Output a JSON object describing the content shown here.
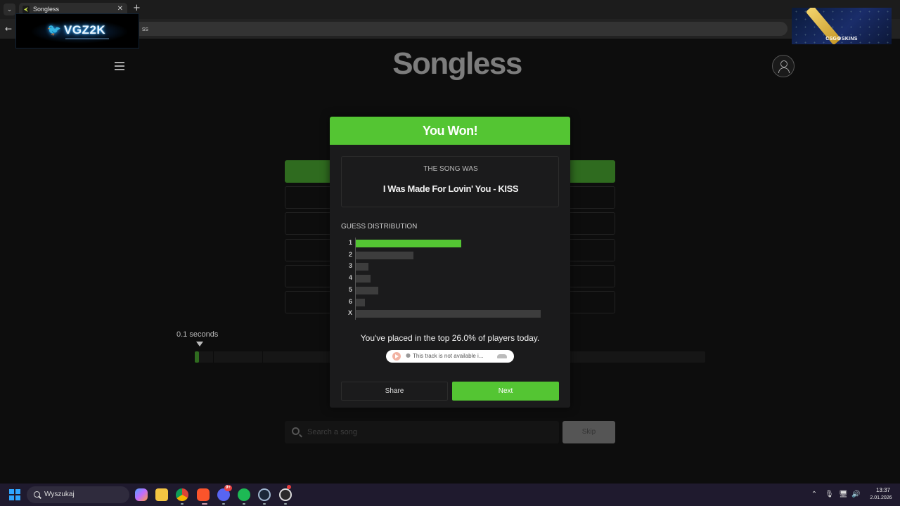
{
  "browser": {
    "tab_title": "Songless",
    "tab_close": "✕",
    "new_tab": "+",
    "address_fragment": "ss"
  },
  "overlays": {
    "streamer_badge": "VGZ2K",
    "sponsor_badge": "CSG⚙SKINS"
  },
  "app": {
    "logo": "Songless",
    "duration_label": "0.1 seconds",
    "progress_fraction": 0.008,
    "search_placeholder": "Search a song",
    "skip_label": "Skip"
  },
  "modal": {
    "title": "You Won!",
    "song_label": "THE SONG WAS",
    "song_title": "I Was Made For Lovin' You - KISS",
    "distribution_title": "GUESS DISTRIBUTION",
    "distribution": [
      {
        "label": "1",
        "value": 0.57,
        "highlight": true
      },
      {
        "label": "2",
        "value": 0.31,
        "highlight": false
      },
      {
        "label": "3",
        "value": 0.07,
        "highlight": false
      },
      {
        "label": "4",
        "value": 0.08,
        "highlight": false
      },
      {
        "label": "5",
        "value": 0.12,
        "highlight": false
      },
      {
        "label": "6",
        "value": 0.05,
        "highlight": false
      },
      {
        "label": "X",
        "value": 1.0,
        "highlight": false
      }
    ],
    "placement_text": "You've placed in the top 26.0% of players today.",
    "soundcloud_text": "This track is not available i...",
    "share_label": "Share",
    "next_label": "Next"
  },
  "taskbar": {
    "search_label": "Wyszukaj",
    "discord_badge": "9+",
    "time": "13:37",
    "date": "2.01.2026"
  },
  "colors": {
    "accent_green": "#54c533",
    "dim_green": "#2f6b1f",
    "bar_grey": "#3d3d3d"
  }
}
